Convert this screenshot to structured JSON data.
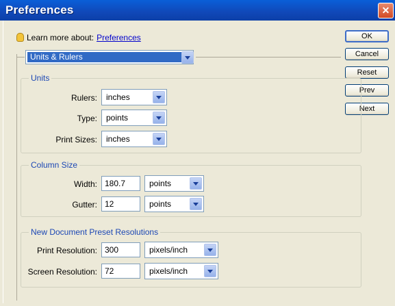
{
  "window": {
    "title": "Preferences"
  },
  "learn_more": {
    "label": "Learn more about:",
    "link": "Preferences"
  },
  "category": {
    "selected": "Units & Rulers"
  },
  "buttons": {
    "ok": "OK",
    "cancel": "Cancel",
    "reset": "Reset",
    "prev": "Prev",
    "next": "Next"
  },
  "units": {
    "legend": "Units",
    "rulers": {
      "label": "Rulers:",
      "value": "inches"
    },
    "type": {
      "label": "Type:",
      "value": "points"
    },
    "print_sizes": {
      "label": "Print Sizes:",
      "value": "inches"
    }
  },
  "column_size": {
    "legend": "Column Size",
    "width": {
      "label": "Width:",
      "value": "180.7",
      "unit": "points"
    },
    "gutter": {
      "label": "Gutter:",
      "value": "12",
      "unit": "points"
    }
  },
  "preset_resolutions": {
    "legend": "New Document Preset Resolutions",
    "print": {
      "label": "Print Resolution:",
      "value": "300",
      "unit": "pixels/inch"
    },
    "screen": {
      "label": "Screen Resolution:",
      "value": "72",
      "unit": "pixels/inch"
    }
  }
}
